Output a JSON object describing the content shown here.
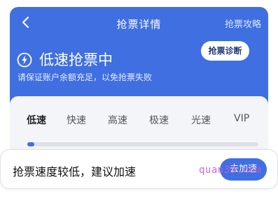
{
  "header": {
    "title": "抢票详情",
    "guide_link": "抢票攻略",
    "status_title": "低速抢票中",
    "status_subtitle": "请保证账户余额充足，以免抢票失败",
    "diagnose_button": "抢票诊断",
    "icons": {
      "back": "chevron-left-icon",
      "bolt": "lightning-bolt-icon"
    },
    "bg_color": "#3f6fe0"
  },
  "speed": {
    "tabs": [
      {
        "label": "低速",
        "active": true
      },
      {
        "label": "快速",
        "active": false
      },
      {
        "label": "高速",
        "active": false
      },
      {
        "label": "极速",
        "active": false
      },
      {
        "label": "光速",
        "active": false
      },
      {
        "label": "VIP",
        "active": false
      }
    ],
    "progress": 0.03
  },
  "toast": {
    "message": "抢票速度较低，建议加速",
    "button": "去加速"
  },
  "watermark": "quan33.com"
}
